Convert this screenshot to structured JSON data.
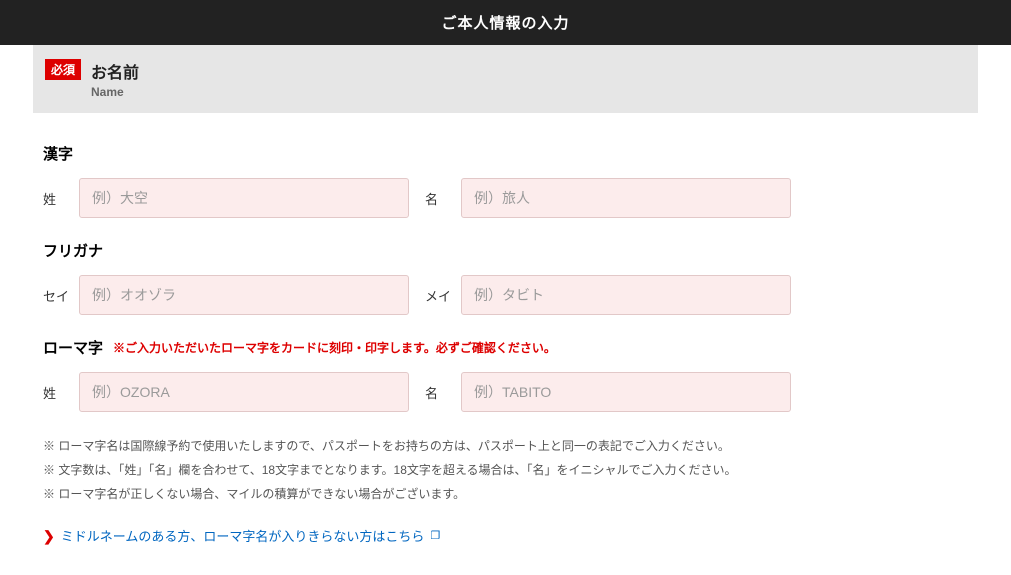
{
  "header": {
    "title": "ご本人情報の入力"
  },
  "section": {
    "required_label": "必須",
    "title_jp": "お名前",
    "title_en": "Name"
  },
  "kanji": {
    "heading": "漢字",
    "last_label": "姓",
    "last_placeholder": "例）大空",
    "first_label": "名",
    "first_placeholder": "例）旅人"
  },
  "furigana": {
    "heading": "フリガナ",
    "last_label": "セイ",
    "last_placeholder": "例）オオゾラ",
    "first_label": "メイ",
    "first_placeholder": "例）タビト"
  },
  "romaji": {
    "heading": "ローマ字",
    "warning": "※ご入力いただいたローマ字をカードに刻印・印字します。必ずご確認ください。",
    "last_label": "姓",
    "last_placeholder": "例）OZORA",
    "first_label": "名",
    "first_placeholder": "例）TABITO"
  },
  "notes": {
    "n1": "※ ローマ字名は国際線予約で使用いたしますので、パスポートをお持ちの方は、パスポート上と同一の表記でご入力ください。",
    "n2": "※ 文字数は、「姓」「名」欄を合わせて、18文字までとなります。18文字を超える場合は、「名」をイニシャルでご入力ください。",
    "n3": "※ ローマ字名が正しくない場合、マイルの積算ができない場合がございます。"
  },
  "link": {
    "text": "ミドルネームのある方、ローマ字名が入りきらない方はこちら"
  }
}
